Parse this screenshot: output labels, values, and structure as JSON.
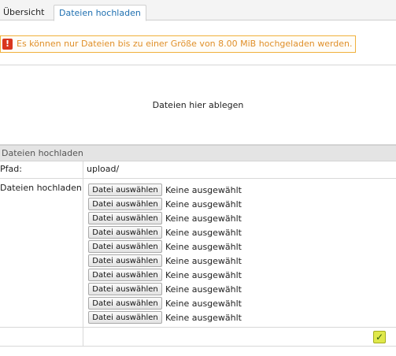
{
  "tabs": [
    {
      "label": "Übersicht"
    },
    {
      "label": "Dateien hochladen"
    }
  ],
  "warning": {
    "icon": "exclamation-icon",
    "text": "Es können nur Dateien bis zu einer Größe von 8.00 MiB hochgeladen werden."
  },
  "dropzone": {
    "text": "Dateien hier ablegen"
  },
  "section": {
    "title": "Dateien hochladen"
  },
  "path": {
    "label": "Pfad:",
    "value": "upload/"
  },
  "files": {
    "label": "Dateien hochladen",
    "inputs": [
      {
        "button": "Datei auswählen",
        "status": "Keine ausgewählt"
      },
      {
        "button": "Datei auswählen",
        "status": "Keine ausgewählt"
      },
      {
        "button": "Datei auswählen",
        "status": "Keine ausgewählt"
      },
      {
        "button": "Datei auswählen",
        "status": "Keine ausgewählt"
      },
      {
        "button": "Datei auswählen",
        "status": "Keine ausgewählt"
      },
      {
        "button": "Datei auswählen",
        "status": "Keine ausgewählt"
      },
      {
        "button": "Datei auswählen",
        "status": "Keine ausgewählt"
      },
      {
        "button": "Datei auswählen",
        "status": "Keine ausgewählt"
      },
      {
        "button": "Datei auswählen",
        "status": "Keine ausgewählt"
      },
      {
        "button": "Datei auswählen",
        "status": "Keine ausgewählt"
      }
    ]
  },
  "submit": {
    "icon": "checkmark-icon",
    "glyph": "✓"
  },
  "colors": {
    "accent": "#1e6fb0",
    "warning": "#e0902a",
    "error": "#d9361e",
    "submit": "#dfe84a"
  }
}
